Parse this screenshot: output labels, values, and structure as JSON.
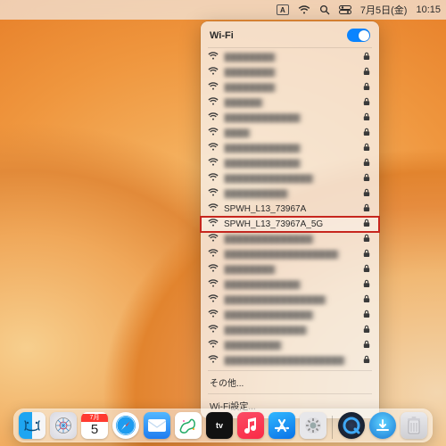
{
  "menubar": {
    "input_indicator": "A",
    "date_text": "7月5日(金)",
    "time_text": "10:15"
  },
  "wifi": {
    "title": "Wi-Fi",
    "toggle_on": true,
    "other_label": "その他...",
    "settings_label": "Wi-Fi設定...",
    "networks": [
      {
        "name": "████████",
        "locked": true,
        "blur": true
      },
      {
        "name": "████████",
        "locked": true,
        "blur": true
      },
      {
        "name": "████████",
        "locked": true,
        "blur": true
      },
      {
        "name": "██████",
        "locked": true,
        "blur": true
      },
      {
        "name": "████████████",
        "locked": true,
        "blur": true
      },
      {
        "name": "████",
        "locked": true,
        "blur": true
      },
      {
        "name": "████████████",
        "locked": true,
        "blur": true
      },
      {
        "name": "████████████",
        "locked": true,
        "blur": true
      },
      {
        "name": "██████████████",
        "locked": true,
        "blur": true
      },
      {
        "name": "██████████",
        "locked": true,
        "blur": true
      },
      {
        "name": "SPWH_L13_73967A",
        "locked": true,
        "blur": false
      },
      {
        "name": "SPWH_L13_73967A_5G",
        "locked": true,
        "blur": false,
        "highlight": true
      },
      {
        "name": "██████████████",
        "locked": true,
        "blur": true
      },
      {
        "name": "██████████████████",
        "locked": true,
        "blur": true
      },
      {
        "name": "████████",
        "locked": true,
        "blur": true
      },
      {
        "name": "████████████",
        "locked": true,
        "blur": true
      },
      {
        "name": "████████████████",
        "locked": true,
        "blur": true
      },
      {
        "name": "██████████████",
        "locked": true,
        "blur": true
      },
      {
        "name": "█████████████",
        "locked": true,
        "blur": true
      },
      {
        "name": "█████████",
        "locked": true,
        "blur": true
      },
      {
        "name": "███████████████████",
        "locked": true,
        "blur": true
      }
    ]
  },
  "dock": {
    "calendar_month": "7月",
    "calendar_day": "5",
    "tv_label": "tv",
    "items": [
      "finder",
      "launchpad",
      "calendar",
      "safari",
      "mail",
      "freeform",
      "tv",
      "music",
      "appstore",
      "settings"
    ]
  }
}
